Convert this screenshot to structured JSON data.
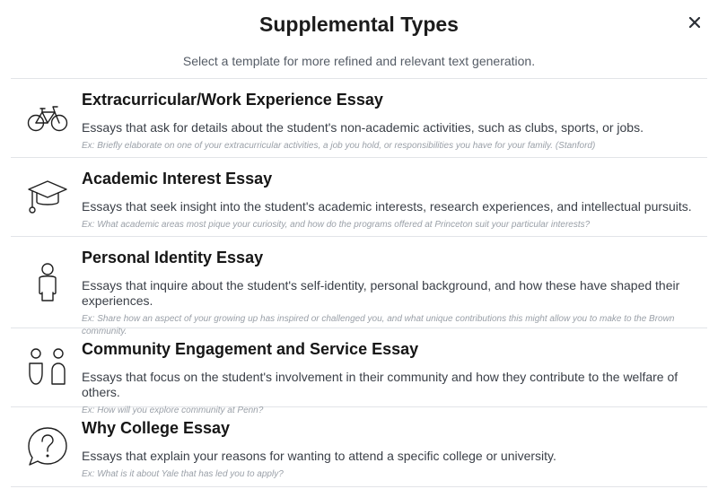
{
  "modal": {
    "title": "Supplemental Types",
    "subtitle": "Select a template for more refined and relevant text generation.",
    "close_icon": "close-icon"
  },
  "types": [
    {
      "icon": "bicycle-icon",
      "title": "Extracurricular/Work Experience Essay",
      "description": "Essays that ask for details about the student's non-academic activities, such as clubs, sports, or jobs.",
      "example": "Ex: Briefly elaborate on one of your extracurricular activities, a job you hold, or responsibilities you have for your family. (Stanford)"
    },
    {
      "icon": "graduation-cap-icon",
      "title": "Academic Interest Essay",
      "description": "Essays that seek insight into the student's academic interests, research experiences, and intellectual pursuits.",
      "example": "Ex: What academic areas most pique your curiosity, and how do the programs offered at Princeton suit your particular interests?"
    },
    {
      "icon": "person-icon",
      "title": "Personal Identity Essay",
      "description": "Essays that inquire about the student's self-identity, personal background, and how these have shaped their experiences.",
      "example": "Ex: Share how an aspect of your growing up has inspired or challenged you, and what unique contributions this might allow you to make to the Brown community."
    },
    {
      "icon": "two-people-icon",
      "title": "Community Engagement and Service Essay",
      "description": "Essays that focus on the student's involvement in their community and how they contribute to the welfare of others.",
      "example": "Ex: How will you explore community at Penn?"
    },
    {
      "icon": "question-bubble-icon",
      "title": "Why College Essay",
      "description": "Essays that explain your reasons for wanting to attend a specific college or university.",
      "example": "Ex: What is it about Yale that has led you to apply?"
    }
  ]
}
